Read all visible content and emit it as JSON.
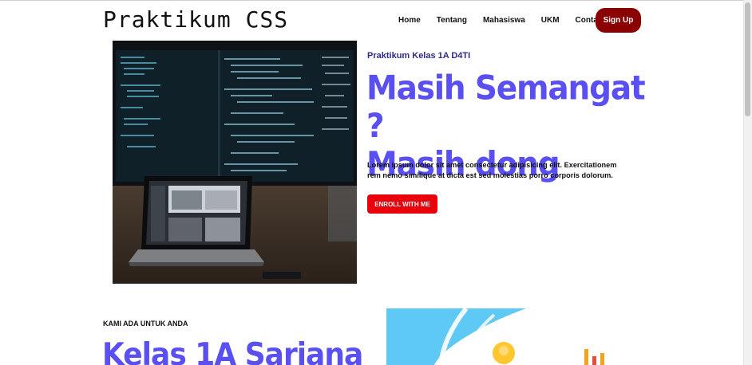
{
  "brand": "Praktikum CSS",
  "nav": {
    "items": [
      "Home",
      "Tentang",
      "Mahasiswa",
      "UKM",
      "Contact"
    ],
    "signup_label": "Sign Up"
  },
  "hero": {
    "kicker": "Praktikum Kelas 1A D4TI",
    "headline_line1": "Masih Semangat ?",
    "headline_line2": "Masih dong",
    "lead": "Lorem ipsum dolor sit amet consectetur adipisicing elit. Exercitationem rem nemo similique at dicta est sed molestias porro corporis dolorum.",
    "enroll_label": "ENROLL WITH ME"
  },
  "section": {
    "kicker": "KAMI ADA UNTUK ANDA",
    "title": "Kelas 1A Sarjana"
  },
  "colors": {
    "accent": "#5a4ff0",
    "signup": "#8b0000",
    "enroll": "#e8000a",
    "kicker": "#2e2a8a"
  }
}
